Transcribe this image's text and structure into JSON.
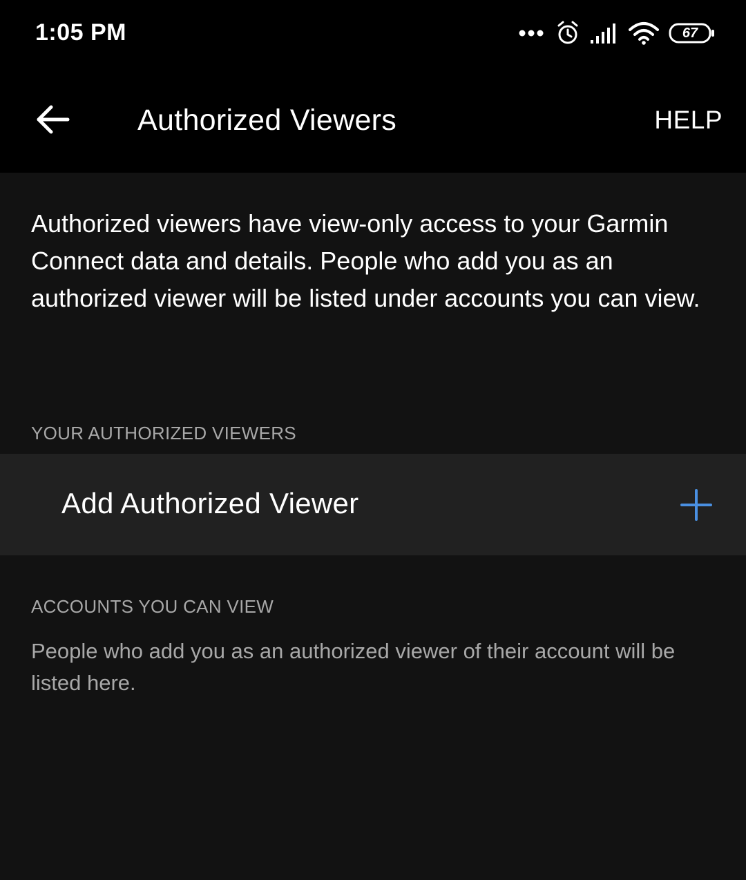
{
  "status_bar": {
    "time": "1:05 PM",
    "icons": [
      "more-dots-icon",
      "alarm-icon",
      "signal-icon",
      "wifi-icon",
      "battery-icon"
    ],
    "battery_level": "67"
  },
  "app_bar": {
    "back_icon": "arrow-left-icon",
    "title": "Authorized Viewers",
    "help_label": "HELP"
  },
  "intro": {
    "text": "Authorized viewers have view-only access to your Garmin Connect data and details. People who add you as an authorized viewer will be listed under accounts you can view."
  },
  "your_viewers": {
    "header": "YOUR AUTHORIZED VIEWERS",
    "add_label": "Add Authorized Viewer",
    "add_icon": "plus-icon"
  },
  "accounts": {
    "header": "ACCOUNTS YOU CAN VIEW",
    "empty_text": "People who add you as an authorized viewer of their account will be listed here."
  },
  "colors": {
    "background": "#121212",
    "bar_background": "#000000",
    "row_background": "#212121",
    "accent": "#4a90e2",
    "secondary_text": "#a8a8a8"
  }
}
